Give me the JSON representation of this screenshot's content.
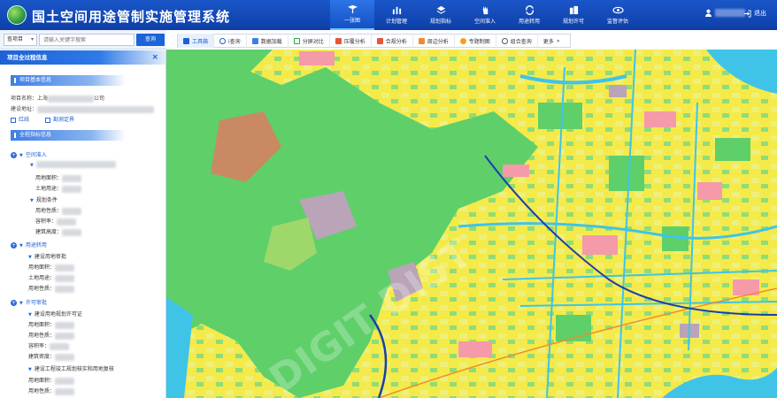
{
  "header": {
    "title": "国土空间用途管制实施管理系统",
    "nav": [
      {
        "label": "一张图",
        "icon": "map-pin-icon",
        "active": true
      },
      {
        "label": "计划管理",
        "icon": "bar-chart-icon"
      },
      {
        "label": "规划指标",
        "icon": "layers-icon"
      },
      {
        "label": "空间准入",
        "icon": "hand-icon"
      },
      {
        "label": "用途转用",
        "icon": "refresh-icon"
      },
      {
        "label": "规划许可",
        "icon": "building-icon"
      },
      {
        "label": "监督评估",
        "icon": "eye-icon"
      }
    ],
    "logout": "退出"
  },
  "search": {
    "select_value": "查项目",
    "placeholder": "请输入关键字搜索",
    "button": "查询"
  },
  "panel": {
    "title": "项目全过程信息",
    "close": "×",
    "basic_section": "项目基本信息",
    "project_name_label": "项目名称：",
    "project_name_prefix": "上海",
    "project_name_suffix": "公司",
    "address_label": "建设地址：",
    "checks": [
      "红线",
      "勘测定界"
    ],
    "process_section": "全程指标信息",
    "tree": {
      "access": "空间准入",
      "land_area": "用地面积：",
      "land_use": "土地用途：",
      "planning": "规划条件",
      "land_nature": "用地性质：",
      "plot_ratio": "容积率：",
      "building_height": "建筑高度：",
      "conversion": "用途转用",
      "approval": "建设用地审批",
      "permit": "许可审批",
      "planning_permit": "建设用地规划许可证",
      "building_density": "建筑密度：",
      "engineering": "建设工程竣工规划核实和用地复核"
    }
  },
  "toolbar": {
    "items": [
      "工具箱",
      "i查询",
      "数据加载",
      "分屏对比",
      "压覆分析",
      "合规分析",
      "周边分析",
      "专题制图",
      "组合查询",
      "更多"
    ],
    "more_arrow": "»"
  },
  "colors": {
    "header": "#1554c4",
    "accent": "#1f5fcf",
    "farmland": "#f4ea4a",
    "forest": "#5fcf6a",
    "water": "#3fc4e8",
    "urban": "#f59aa8"
  },
  "watermark": "DIGIT DIST"
}
